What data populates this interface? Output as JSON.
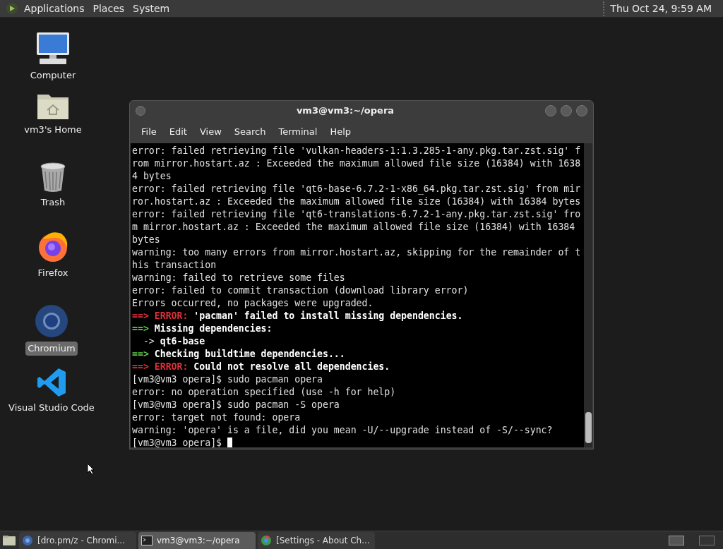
{
  "top_panel": {
    "menus": [
      "Applications",
      "Places",
      "System"
    ],
    "clock": "Thu Oct 24,  9:59 AM"
  },
  "desktop_icons": [
    {
      "kind": "computer",
      "label": "Computer",
      "selected": false
    },
    {
      "kind": "home",
      "label": "vm3's Home",
      "selected": false
    },
    {
      "kind": "trash",
      "label": "Trash",
      "selected": false
    },
    {
      "kind": "firefox",
      "label": "Firefox",
      "selected": false
    },
    {
      "kind": "chromium",
      "label": "Chromium",
      "selected": true
    },
    {
      "kind": "vscode",
      "label": "Visual Studio Code",
      "selected": false
    }
  ],
  "terminal": {
    "title": "vm3@vm3:~/opera",
    "menu": [
      "File",
      "Edit",
      "View",
      "Search",
      "Terminal",
      "Help"
    ],
    "lines": [
      [
        {
          "text": "error: failed retrieving file 'vulkan-headers-1:1.3.285-1-any.pkg.tar.zst.sig' f",
          "kind": "plain"
        }
      ],
      [
        {
          "text": "rom mirror.hostart.az : Exceeded the maximum allowed file size (16384) with 1638",
          "kind": "plain"
        }
      ],
      [
        {
          "text": "4 bytes",
          "kind": "plain"
        }
      ],
      [
        {
          "text": "error: failed retrieving file 'qt6-base-6.7.2-1-x86_64.pkg.tar.zst.sig' from mir",
          "kind": "plain"
        }
      ],
      [
        {
          "text": "ror.hostart.az : Exceeded the maximum allowed file size (16384) with 16384 bytes",
          "kind": "plain"
        }
      ],
      [
        {
          "text": "error: failed retrieving file 'qt6-translations-6.7.2-1-any.pkg.tar.zst.sig' fro",
          "kind": "plain"
        }
      ],
      [
        {
          "text": "m mirror.hostart.az : Exceeded the maximum allowed file size (16384) with 16384",
          "kind": "plain"
        }
      ],
      [
        {
          "text": "bytes",
          "kind": "plain"
        }
      ],
      [
        {
          "text": "warning: too many errors from mirror.hostart.az, skipping for the remainder of t",
          "kind": "plain"
        }
      ],
      [
        {
          "text": "his transaction",
          "kind": "plain"
        }
      ],
      [
        {
          "text": "warning: failed to retrieve some files",
          "kind": "plain"
        }
      ],
      [
        {
          "text": "error: failed to commit transaction (download library error)",
          "kind": "plain"
        }
      ],
      [
        {
          "text": "Errors occurred, no packages were upgraded.",
          "kind": "plain"
        }
      ],
      [
        {
          "text": "==> ERROR:",
          "kind": "red"
        },
        {
          "text": " 'pacman' failed to install missing dependencies.",
          "kind": "bold"
        }
      ],
      [
        {
          "text": "==>",
          "kind": "green"
        },
        {
          "text": " Missing dependencies:",
          "kind": "bold"
        }
      ],
      [
        {
          "text": "  ->",
          "kind": "plain"
        },
        {
          "text": " qt6-base",
          "kind": "bold"
        }
      ],
      [
        {
          "text": "==>",
          "kind": "green"
        },
        {
          "text": " Checking buildtime dependencies...",
          "kind": "bold"
        }
      ],
      [
        {
          "text": "==> ERROR:",
          "kind": "red"
        },
        {
          "text": " Could not resolve all dependencies.",
          "kind": "bold"
        }
      ],
      [
        {
          "text": "[vm3@vm3 opera]$ sudo pacman opera",
          "kind": "plain"
        }
      ],
      [
        {
          "text": "error: no operation specified (use -h for help)",
          "kind": "plain"
        }
      ],
      [
        {
          "text": "[vm3@vm3 opera]$ sudo pacman -S opera",
          "kind": "plain"
        }
      ],
      [
        {
          "text": "error: target not found: opera",
          "kind": "plain"
        }
      ],
      [
        {
          "text": "warning: 'opera' is a file, did you mean -U/--upgrade instead of -S/--sync?",
          "kind": "plain"
        }
      ],
      [
        {
          "text": "[vm3@vm3 opera]$",
          "kind": "plain"
        }
      ]
    ]
  },
  "taskbar": [
    {
      "kind": "browser",
      "label": "[dro.pm/z - Chromi...",
      "selected": false
    },
    {
      "kind": "terminal",
      "label": "vm3@vm3:~/opera",
      "selected": true
    },
    {
      "kind": "chrome",
      "label": "[Settings - About Ch...",
      "selected": false
    }
  ]
}
